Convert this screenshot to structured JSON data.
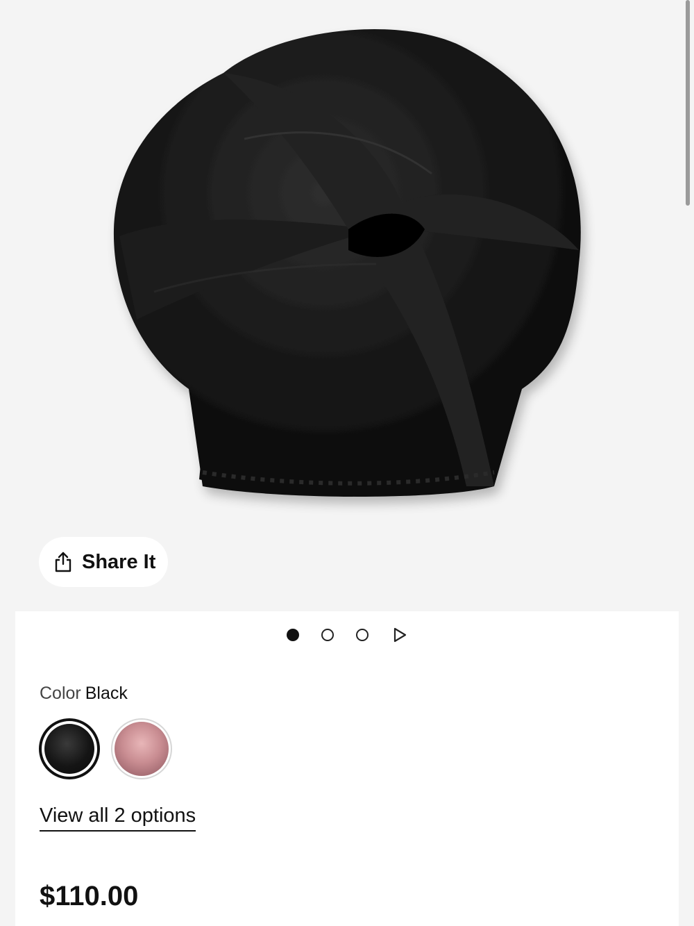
{
  "share": {
    "label": "Share It",
    "icon": "share-icon"
  },
  "carousel": {
    "slides": 3,
    "active_index": 0,
    "has_video": true,
    "icons": [
      "dot-active",
      "dot-inactive",
      "dot-inactive",
      "play-icon"
    ]
  },
  "color": {
    "label": "Color",
    "selected": "Black",
    "swatches": [
      {
        "name": "Black",
        "selected": true
      },
      {
        "name": "Pink",
        "selected": false
      }
    ]
  },
  "options": {
    "view_all_label": "View all 2 options"
  },
  "price": {
    "amount": "$110.00"
  },
  "colors": {
    "hero_bg": "#f4f4f4",
    "text": "#111111",
    "product": "#111111"
  }
}
